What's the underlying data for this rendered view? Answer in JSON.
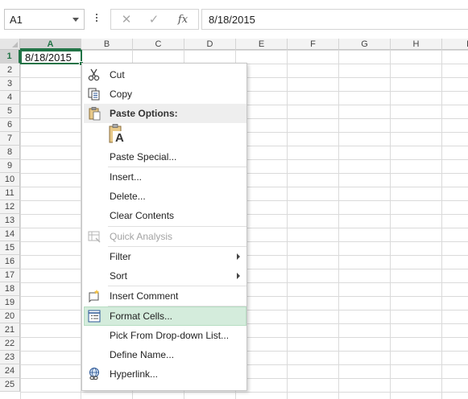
{
  "formula_bar": {
    "name_box": "A1",
    "cancel_glyph": "✕",
    "enter_glyph": "✓",
    "fx_label": "fx",
    "formula_value": "8/18/2015"
  },
  "grid": {
    "columns": [
      "A",
      "B",
      "C",
      "D",
      "E",
      "F",
      "G",
      "H",
      "I"
    ],
    "rows": [
      "1",
      "2",
      "3",
      "4",
      "5",
      "6",
      "7",
      "8",
      "9",
      "10",
      "11",
      "12",
      "13",
      "14",
      "15",
      "16",
      "17",
      "18",
      "19",
      "20",
      "21",
      "22",
      "23",
      "24",
      "25"
    ],
    "active_column": "A",
    "active_row": "1",
    "cell_a1": "8/18/2015"
  },
  "context_menu": {
    "items": [
      {
        "label": "Cut",
        "icon": "scissors-icon",
        "enabled": true
      },
      {
        "label": "Copy",
        "icon": "copy-icon",
        "enabled": true
      },
      {
        "label": "Paste Options:",
        "icon": "clipboard-icon",
        "header": true
      },
      {
        "label": "Paste Special...",
        "enabled": true
      },
      {
        "label": "Insert...",
        "enabled": true
      },
      {
        "label": "Delete...",
        "enabled": true
      },
      {
        "label": "Clear Contents",
        "enabled": true
      },
      {
        "label": "Quick Analysis",
        "icon": "quick-analysis-icon",
        "enabled": false
      },
      {
        "label": "Filter",
        "enabled": true,
        "submenu": true
      },
      {
        "label": "Sort",
        "enabled": true,
        "submenu": true
      },
      {
        "label": "Insert Comment",
        "icon": "comment-icon",
        "enabled": true
      },
      {
        "label": "Format Cells...",
        "icon": "format-cells-icon",
        "enabled": true,
        "hovered": true
      },
      {
        "label": "Pick From Drop-down List...",
        "enabled": true
      },
      {
        "label": "Define Name...",
        "enabled": true
      },
      {
        "label": "Hyperlink...",
        "icon": "hyperlink-icon",
        "enabled": true
      }
    ],
    "paste_option_glyph": "A",
    "accent_color": "#217346",
    "hover_color": "#d4ecdc"
  }
}
